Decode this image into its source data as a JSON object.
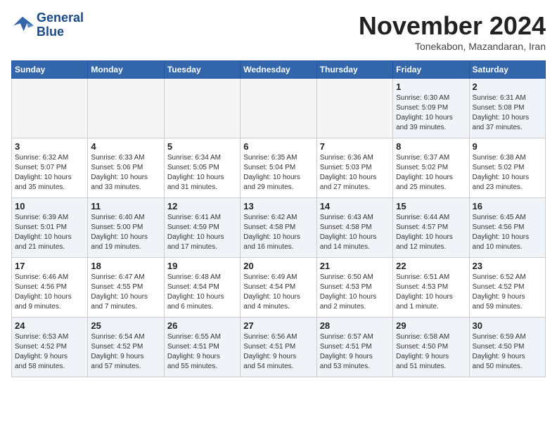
{
  "header": {
    "logo_line1": "General",
    "logo_line2": "Blue",
    "month": "November 2024",
    "location": "Tonekabon, Mazandaran, Iran"
  },
  "weekdays": [
    "Sunday",
    "Monday",
    "Tuesday",
    "Wednesday",
    "Thursday",
    "Friday",
    "Saturday"
  ],
  "weeks": [
    [
      {
        "day": "",
        "info": ""
      },
      {
        "day": "",
        "info": ""
      },
      {
        "day": "",
        "info": ""
      },
      {
        "day": "",
        "info": ""
      },
      {
        "day": "",
        "info": ""
      },
      {
        "day": "1",
        "info": "Sunrise: 6:30 AM\nSunset: 5:09 PM\nDaylight: 10 hours\nand 39 minutes."
      },
      {
        "day": "2",
        "info": "Sunrise: 6:31 AM\nSunset: 5:08 PM\nDaylight: 10 hours\nand 37 minutes."
      }
    ],
    [
      {
        "day": "3",
        "info": "Sunrise: 6:32 AM\nSunset: 5:07 PM\nDaylight: 10 hours\nand 35 minutes."
      },
      {
        "day": "4",
        "info": "Sunrise: 6:33 AM\nSunset: 5:06 PM\nDaylight: 10 hours\nand 33 minutes."
      },
      {
        "day": "5",
        "info": "Sunrise: 6:34 AM\nSunset: 5:05 PM\nDaylight: 10 hours\nand 31 minutes."
      },
      {
        "day": "6",
        "info": "Sunrise: 6:35 AM\nSunset: 5:04 PM\nDaylight: 10 hours\nand 29 minutes."
      },
      {
        "day": "7",
        "info": "Sunrise: 6:36 AM\nSunset: 5:03 PM\nDaylight: 10 hours\nand 27 minutes."
      },
      {
        "day": "8",
        "info": "Sunrise: 6:37 AM\nSunset: 5:02 PM\nDaylight: 10 hours\nand 25 minutes."
      },
      {
        "day": "9",
        "info": "Sunrise: 6:38 AM\nSunset: 5:02 PM\nDaylight: 10 hours\nand 23 minutes."
      }
    ],
    [
      {
        "day": "10",
        "info": "Sunrise: 6:39 AM\nSunset: 5:01 PM\nDaylight: 10 hours\nand 21 minutes."
      },
      {
        "day": "11",
        "info": "Sunrise: 6:40 AM\nSunset: 5:00 PM\nDaylight: 10 hours\nand 19 minutes."
      },
      {
        "day": "12",
        "info": "Sunrise: 6:41 AM\nSunset: 4:59 PM\nDaylight: 10 hours\nand 17 minutes."
      },
      {
        "day": "13",
        "info": "Sunrise: 6:42 AM\nSunset: 4:58 PM\nDaylight: 10 hours\nand 16 minutes."
      },
      {
        "day": "14",
        "info": "Sunrise: 6:43 AM\nSunset: 4:58 PM\nDaylight: 10 hours\nand 14 minutes."
      },
      {
        "day": "15",
        "info": "Sunrise: 6:44 AM\nSunset: 4:57 PM\nDaylight: 10 hours\nand 12 minutes."
      },
      {
        "day": "16",
        "info": "Sunrise: 6:45 AM\nSunset: 4:56 PM\nDaylight: 10 hours\nand 10 minutes."
      }
    ],
    [
      {
        "day": "17",
        "info": "Sunrise: 6:46 AM\nSunset: 4:56 PM\nDaylight: 10 hours\nand 9 minutes."
      },
      {
        "day": "18",
        "info": "Sunrise: 6:47 AM\nSunset: 4:55 PM\nDaylight: 10 hours\nand 7 minutes."
      },
      {
        "day": "19",
        "info": "Sunrise: 6:48 AM\nSunset: 4:54 PM\nDaylight: 10 hours\nand 6 minutes."
      },
      {
        "day": "20",
        "info": "Sunrise: 6:49 AM\nSunset: 4:54 PM\nDaylight: 10 hours\nand 4 minutes."
      },
      {
        "day": "21",
        "info": "Sunrise: 6:50 AM\nSunset: 4:53 PM\nDaylight: 10 hours\nand 2 minutes."
      },
      {
        "day": "22",
        "info": "Sunrise: 6:51 AM\nSunset: 4:53 PM\nDaylight: 10 hours\nand 1 minute."
      },
      {
        "day": "23",
        "info": "Sunrise: 6:52 AM\nSunset: 4:52 PM\nDaylight: 9 hours\nand 59 minutes."
      }
    ],
    [
      {
        "day": "24",
        "info": "Sunrise: 6:53 AM\nSunset: 4:52 PM\nDaylight: 9 hours\nand 58 minutes."
      },
      {
        "day": "25",
        "info": "Sunrise: 6:54 AM\nSunset: 4:52 PM\nDaylight: 9 hours\nand 57 minutes."
      },
      {
        "day": "26",
        "info": "Sunrise: 6:55 AM\nSunset: 4:51 PM\nDaylight: 9 hours\nand 55 minutes."
      },
      {
        "day": "27",
        "info": "Sunrise: 6:56 AM\nSunset: 4:51 PM\nDaylight: 9 hours\nand 54 minutes."
      },
      {
        "day": "28",
        "info": "Sunrise: 6:57 AM\nSunset: 4:51 PM\nDaylight: 9 hours\nand 53 minutes."
      },
      {
        "day": "29",
        "info": "Sunrise: 6:58 AM\nSunset: 4:50 PM\nDaylight: 9 hours\nand 51 minutes."
      },
      {
        "day": "30",
        "info": "Sunrise: 6:59 AM\nSunset: 4:50 PM\nDaylight: 9 hours\nand 50 minutes."
      }
    ]
  ]
}
